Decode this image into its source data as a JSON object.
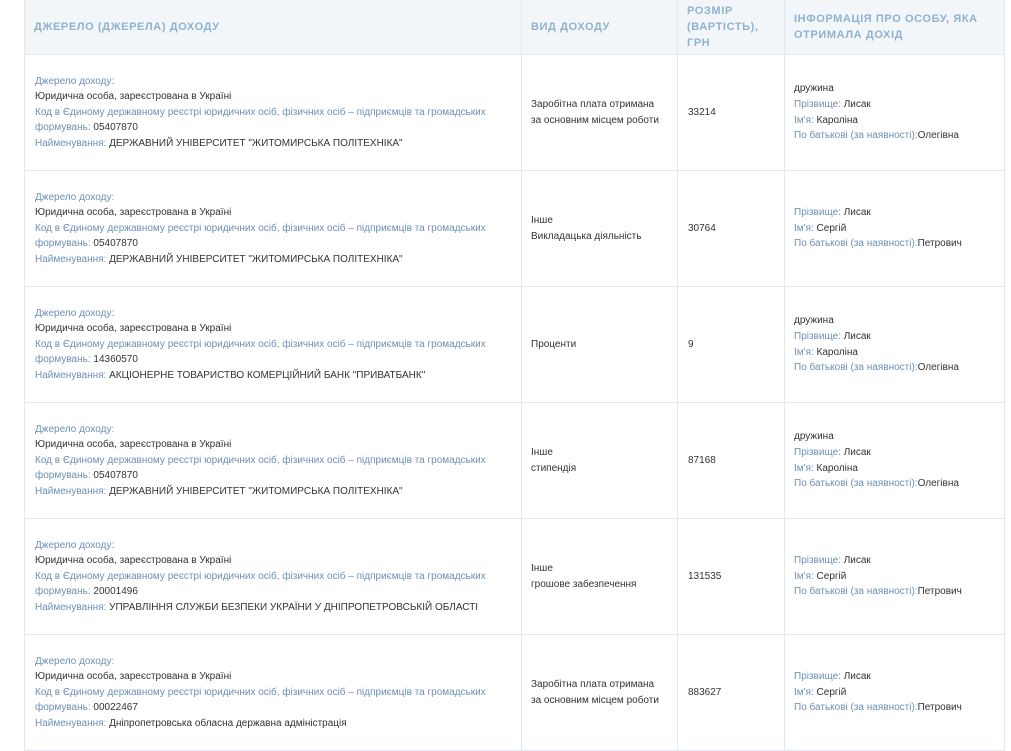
{
  "header": {
    "col_source": "ДЖЕРЕЛО (ДЖЕРЕЛА) ДОХОДУ",
    "col_type": "ВИД ДОХОДУ",
    "col_amount": "РОЗМІР (ВАРТІСТЬ), ГРН",
    "col_person": "ІНФОРМАЦІЯ ПРО ОСОБУ, ЯКА ОТРИМАЛА ДОХІД"
  },
  "labels": {
    "source": "Джерело доходу:",
    "code": "Код в Єдиному державному реєстрі юридичних осіб, фізичних осіб – підприємців та громадських формувань:",
    "name": "Найменування:",
    "surname": "Прізвище:",
    "first_name": "Ім'я:",
    "patronymic": "По батькові (за наявності):"
  },
  "rows": [
    {
      "entity_type": "Юридична особа, зареєстрована в Україні",
      "code": "05407870",
      "name": "ДЕРЖАВНИЙ УНІВЕРСИТЕТ \"ЖИТОМИРСЬКА ПОЛІТЕХНІКА\"",
      "type_lines": [
        "Заробітна плата отримана за основним місцем роботи"
      ],
      "amount": "33214",
      "relation": "дружина",
      "surname": "Лисак",
      "first_name": "Кароліна",
      "patronymic": "Олегівна"
    },
    {
      "entity_type": "Юридична особа, зареєстрована в Україні",
      "code": "05407870",
      "name": "ДЕРЖАВНИЙ УНІВЕРСИТЕТ \"ЖИТОМИРСЬКА ПОЛІТЕХНІКА\"",
      "type_lines": [
        "Інше",
        "Викладацька діяльність"
      ],
      "amount": "30764",
      "relation": "",
      "surname": "Лисак",
      "first_name": "Сергій",
      "patronymic": "Петрович"
    },
    {
      "entity_type": "Юридична особа, зареєстрована в Україні",
      "code": "14360570",
      "name": "АКЦІОНЕРНЕ ТОВАРИСТВО КОМЕРЦІЙНИЙ БАНК \"ПРИВАТБАНК\"",
      "type_lines": [
        "Проценти"
      ],
      "amount": "9",
      "relation": "дружина",
      "surname": "Лисак",
      "first_name": "Кароліна",
      "patronymic": "Олегівна"
    },
    {
      "entity_type": "Юридична особа, зареєстрована в Україні",
      "code": "05407870",
      "name": "ДЕРЖАВНИЙ УНІВЕРСИТЕТ \"ЖИТОМИРСЬКА ПОЛІТЕХНІКА\"",
      "type_lines": [
        "Інше",
        "стипендія"
      ],
      "amount": "87168",
      "relation": "дружина",
      "surname": "Лисак",
      "first_name": "Кароліна",
      "patronymic": "Олегівна"
    },
    {
      "entity_type": "Юридична особа, зареєстрована в Україні",
      "code": "20001496",
      "name": "УПРАВЛІННЯ СЛУЖБИ БЕЗПЕКИ УКРАЇНИ У ДНІПРОПЕТРОВСЬКІЙ ОБЛАСТІ",
      "type_lines": [
        "Інше",
        "грошове забезпечення"
      ],
      "amount": "131535",
      "relation": "",
      "surname": "Лисак",
      "first_name": "Сергій",
      "patronymic": "Петрович"
    },
    {
      "entity_type": "Юридична особа, зареєстрована в Україні",
      "code": "00022467",
      "name": "Дніпропетровська обласна державна адміністрація",
      "type_lines": [
        "Заробітна плата отримана за основним місцем роботи"
      ],
      "amount": "883627",
      "relation": "",
      "surname": "Лисак",
      "first_name": "Сергій",
      "patronymic": "Петрович"
    }
  ]
}
